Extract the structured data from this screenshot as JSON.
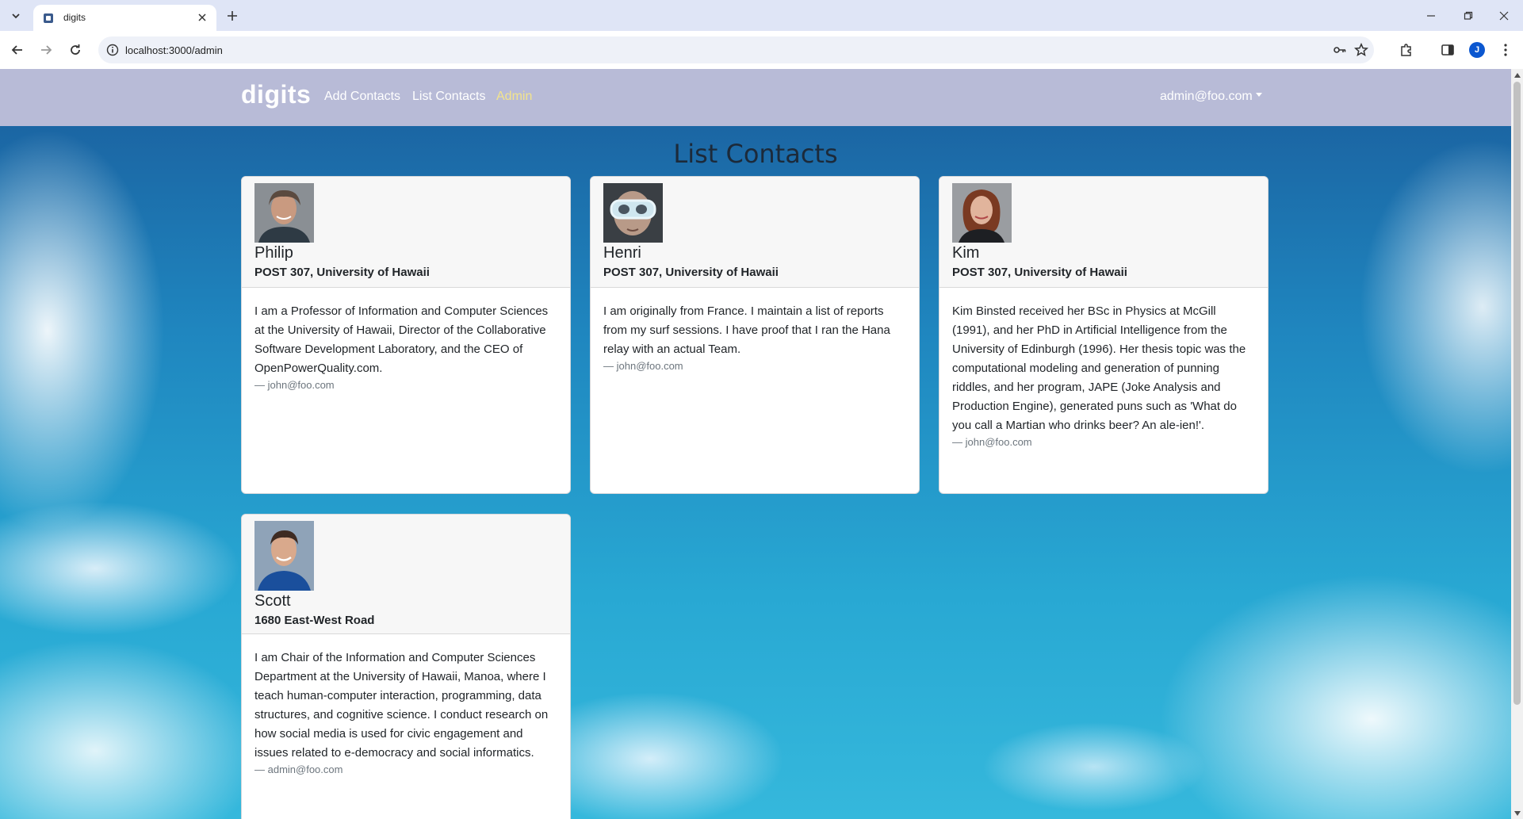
{
  "browser": {
    "tab_title": "digits",
    "url": "localhost:3000/admin",
    "profile_initial": "J"
  },
  "navbar": {
    "brand": "digits",
    "links": [
      {
        "label": "Add Contacts",
        "active": false
      },
      {
        "label": "List Contacts",
        "active": false
      },
      {
        "label": "Admin",
        "active": true
      }
    ],
    "user": "admin@foo.com"
  },
  "page": {
    "title": "List Contacts"
  },
  "contacts": [
    {
      "name": "Philip",
      "address": "POST 307, University of Hawaii",
      "description": "I am a Professor of Information and Computer Sciences at the University of Hawaii, Director of the Collaborative Software Development Laboratory, and the CEO of OpenPowerQuality.com.",
      "owner": "— john@foo.com"
    },
    {
      "name": "Henri",
      "address": "POST 307, University of Hawaii",
      "description": "I am originally from France. I maintain a list of reports from my surf sessions. I have proof that I ran the Hana relay with an actual Team.",
      "owner": "— john@foo.com"
    },
    {
      "name": "Kim",
      "address": "POST 307, University of Hawaii",
      "description": "Kim Binsted received her BSc in Physics at McGill (1991), and her PhD in Artificial Intelligence from the University of Edinburgh (1996). Her thesis topic was the computational modeling and generation of punning riddles, and her program, JAPE (Joke Analysis and Production Engine), generated puns such as 'What do you call a Martian who drinks beer? An ale-ien!'.",
      "owner": "— john@foo.com"
    },
    {
      "name": "Scott",
      "address": "1680 East-West Road",
      "description": "I am Chair of the Information and Computer Sciences Department at the University of Hawaii, Manoa, where I teach human-computer interaction, programming, data structures, and cognitive science. I conduct research on how social media is used for civic engagement and issues related to e-democracy and social informatics.",
      "owner": "— admin@foo.com"
    }
  ],
  "colors": {
    "navbar_bg": "#b8bbd7",
    "active_link": "#f3e48c",
    "sky_top": "#1a5d9c",
    "sky_bottom": "#35b8dc"
  }
}
